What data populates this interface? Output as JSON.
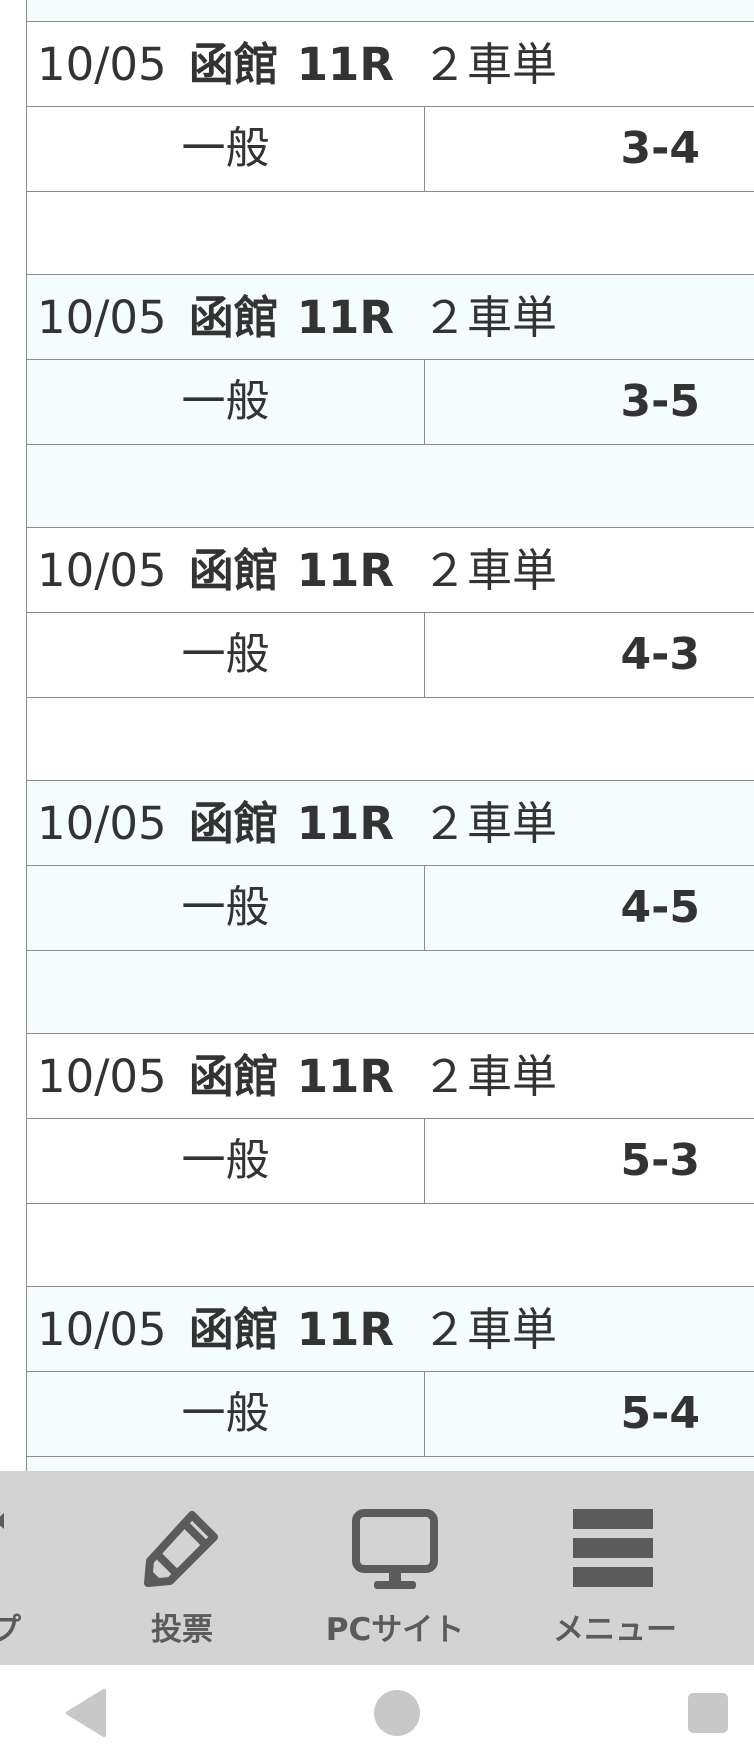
{
  "bets": [
    {
      "date": "10/05",
      "venue": "函館",
      "race": "11R",
      "bet_type": "２車単",
      "ticket_type": "一般",
      "combination": "3-4"
    },
    {
      "date": "10/05",
      "venue": "函館",
      "race": "11R",
      "bet_type": "２車単",
      "ticket_type": "一般",
      "combination": "3-5"
    },
    {
      "date": "10/05",
      "venue": "函館",
      "race": "11R",
      "bet_type": "２車単",
      "ticket_type": "一般",
      "combination": "4-3"
    },
    {
      "date": "10/05",
      "venue": "函館",
      "race": "11R",
      "bet_type": "２車単",
      "ticket_type": "一般",
      "combination": "4-5"
    },
    {
      "date": "10/05",
      "venue": "函館",
      "race": "11R",
      "bet_type": "２車単",
      "ticket_type": "一般",
      "combination": "5-3"
    },
    {
      "date": "10/05",
      "venue": "函館",
      "race": "11R",
      "bet_type": "２車単",
      "ticket_type": "一般",
      "combination": "5-4"
    }
  ],
  "bottom_nav": {
    "vote_label": "投票",
    "vote_icon": "pencil-icon",
    "pc_label": "PCサイト",
    "pc_icon": "monitor-icon",
    "menu_label": "メニュー",
    "menu_icon": "hamburger-menu-icon",
    "partial_label": "プ"
  },
  "system_bar": {
    "back_icon": "back-triangle-icon",
    "home_icon": "home-circle-icon",
    "recents_icon": "recents-square-icon"
  },
  "colors": {
    "row_tint": "#f4fcfd",
    "border": "#8c8c8c",
    "text": "#333333",
    "nav_background": "#d3d3d3",
    "nav_icon": "#5b5b5b",
    "system_icon": "#c8c8c8"
  }
}
